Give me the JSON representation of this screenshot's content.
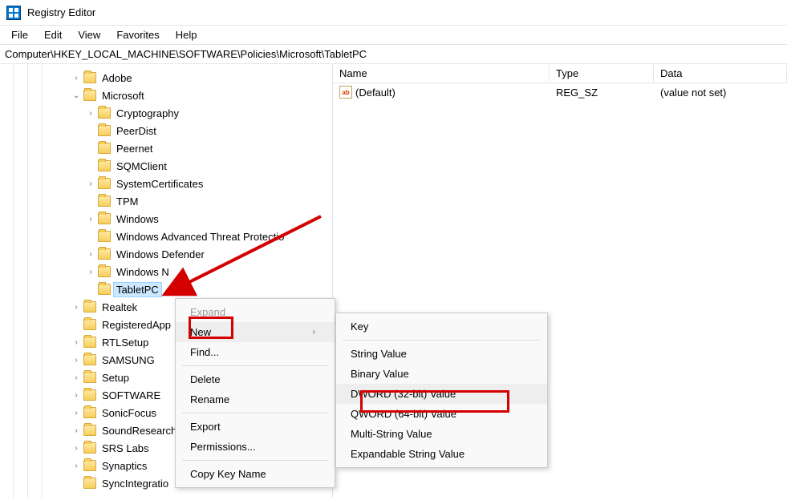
{
  "window": {
    "title": "Registry Editor"
  },
  "menubar": [
    "File",
    "Edit",
    "View",
    "Favorites",
    "Help"
  ],
  "address": "Computer\\HKEY_LOCAL_MACHINE\\SOFTWARE\\Policies\\Microsoft\\TabletPC",
  "columns": {
    "name": "Name",
    "type": "Type",
    "data": "Data"
  },
  "values": [
    {
      "name": "(Default)",
      "type": "REG_SZ",
      "data": "(value not set)"
    }
  ],
  "tree": {
    "adobe": "Adobe",
    "microsoft": "Microsoft",
    "ms_children": [
      {
        "label": "Cryptography",
        "exp": true
      },
      {
        "label": "PeerDist",
        "exp": false
      },
      {
        "label": "Peernet",
        "exp": false
      },
      {
        "label": "SQMClient",
        "exp": false
      },
      {
        "label": "SystemCertificates",
        "exp": true
      },
      {
        "label": "TPM",
        "exp": false
      },
      {
        "label": "Windows",
        "exp": true
      },
      {
        "label": "Windows Advanced Threat Protection",
        "exp": false,
        "trunc": "Windows Advanced Threat Protectio"
      },
      {
        "label": "Windows Defender",
        "exp": true
      },
      {
        "label": "Windows NT",
        "exp": true,
        "trunc": "Windows N"
      },
      {
        "label": "TabletPC",
        "exp": false,
        "selected": true
      }
    ],
    "siblings": [
      {
        "label": "Realtek",
        "exp": true
      },
      {
        "label": "RegisteredApplications",
        "exp": false,
        "trunc": "RegisteredApp"
      },
      {
        "label": "RTLSetup",
        "exp": true
      },
      {
        "label": "SAMSUNG",
        "exp": true
      },
      {
        "label": "Setup",
        "exp": true
      },
      {
        "label": "SOFTWARE",
        "exp": true
      },
      {
        "label": "SonicFocus",
        "exp": true
      },
      {
        "label": "SoundResearch",
        "exp": true,
        "trunc": "SoundResearch"
      },
      {
        "label": "SRS Labs",
        "exp": true
      },
      {
        "label": "Synaptics",
        "exp": true
      },
      {
        "label": "SyncIntegration",
        "exp": false,
        "trunc": "SyncIntegratio"
      }
    ]
  },
  "context_menu": {
    "items": [
      {
        "label": "Expand",
        "disabled": true
      },
      {
        "label": "New",
        "submenu": true,
        "hover": true
      },
      {
        "label": "Find...",
        "sep_after": true
      },
      {
        "label": "Delete"
      },
      {
        "label": "Rename",
        "sep_after": true
      },
      {
        "label": "Export"
      },
      {
        "label": "Permissions...",
        "sep_after": true
      },
      {
        "label": "Copy Key Name"
      }
    ],
    "submenu": [
      {
        "label": "Key",
        "sep_after": true
      },
      {
        "label": "String Value"
      },
      {
        "label": "Binary Value"
      },
      {
        "label": "DWORD (32-bit) Value",
        "hover": true
      },
      {
        "label": "QWORD (64-bit) Value"
      },
      {
        "label": "Multi-String Value"
      },
      {
        "label": "Expandable String Value"
      }
    ]
  }
}
